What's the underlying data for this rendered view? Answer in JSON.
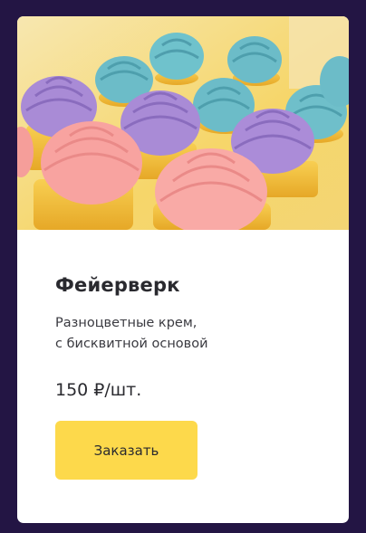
{
  "product": {
    "title": "Фейерверк",
    "description_line1": "Разноцветные крем,",
    "description_line2": "с бисквитной основой",
    "price": "150 ₽/шт.",
    "order_label": "Заказать"
  },
  "colors": {
    "page_background": "#231544",
    "card_background": "#ffffff",
    "button_background": "#fdd94b",
    "frosting_pink": "#f8a3a0",
    "frosting_purple": "#a98bd6",
    "frosting_teal": "#6cbcc8",
    "cake_yellow": "#f2c13c"
  }
}
